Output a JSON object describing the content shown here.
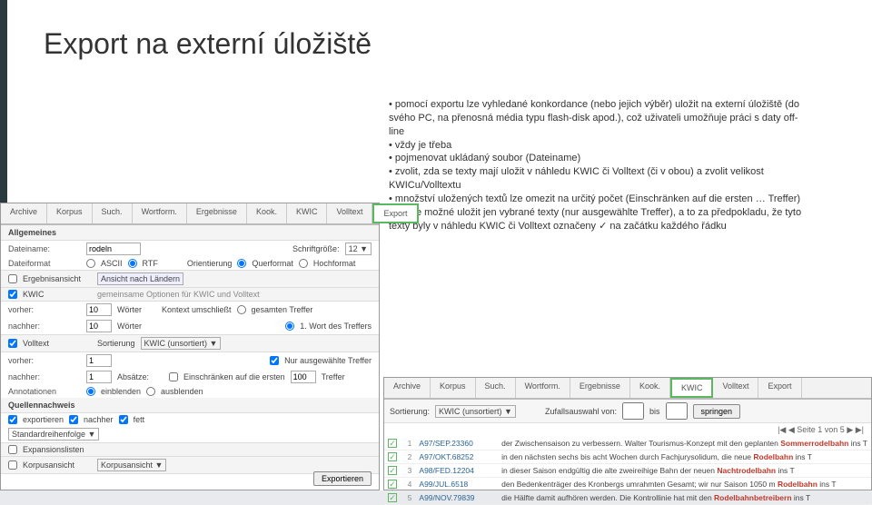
{
  "title": "Export na externí úložiště",
  "explain": [
    "• pomocí exportu lze vyhledané konkordance (nebo jejich výběr) uložit na externí úložiště (do svého PC, na přenosná média typu flash-disk apod.), což uživateli umožňuje práci s daty off-line",
    "• vždy je třeba",
    "• pojmenovat ukládaný soubor (Dateiname)",
    "• zvolit, zda se texty mají uložit v náhledu KWIC či Volltext (či v obou) a zvolit velikost KWICu/Volltextu",
    "• množství uložených textů lze omezit na určitý počet (Einschränken auf die ersten … Treffer) nebo je možné uložit jen vybrané texty (nur ausgewählte Treffer), a to za předpokladu, že tyto texty byly v náhledu KWIC či Volltext označeny ✓ na začátku každého řádku"
  ],
  "menu1": [
    "Archive",
    "Korpus",
    "Such.",
    "Wortform.",
    "Ergebnisse",
    "Kook.",
    "KWIC",
    "Volltext",
    "Export"
  ],
  "menu2": [
    "Archive",
    "Korpus",
    "Such.",
    "Wortform.",
    "Ergebnisse",
    "Kook.",
    "KWIC",
    "Volltext",
    "Export"
  ],
  "shot1": {
    "sect_allg": "Allgemeines",
    "dateiname_lab": "Dateiname:",
    "dateiname_val": "rodeln",
    "schrift_lab": "Schriftgröße:",
    "schrift_val": "12 ▼",
    "format_lab": "Dateiformat",
    "ascii": "ASCII",
    "rtf": "RTF",
    "orient_lab": "Orientierung",
    "quer": "Querformat",
    "hoch": "Hochformat",
    "erg_lab": "Ergebnisansicht",
    "ansicht": "Ansicht nach Ländern",
    "gemein": "gemeinsame Optionen für KWIC und Volltext",
    "kwic_lab": "KWIC",
    "vorher": "vorher:",
    "n10": "10",
    "worter": "Wörter",
    "kontext": "Kontext umschließt",
    "gesamt": "gesamten Treffer",
    "erstes": "1. Wort des Treffers",
    "nachher": "nachher:",
    "voll_lab": "Volltext",
    "sort": "Sortierung",
    "kwicun": "KWIC (unsortiert) ▼",
    "nuraus": "Nur ausgewählte Treffer",
    "absatze": "Absätze:",
    "einschr": "Einschränken auf die ersten",
    "n100": "100",
    "treffer": "Treffer",
    "sect_quell": "Quellennachweis",
    "annot": "Annotationen",
    "einbl": "einblenden",
    "ausbl": "ausblenden",
    "exportieren": "exportieren",
    "nachher2": "nachher",
    "fett": "fett",
    "std": "Standardreihenfolge ▼",
    "sect_exp": "Expansionslisten",
    "sect_korp": "Korpusansicht",
    "korpa": "Korpusansicht ▼",
    "btn": "Exportieren"
  },
  "shot2": {
    "sort_lab": "Sortierung:",
    "sort_val": "KWIC (unsortiert) ▼",
    "zufall": "Zufallsauswahl von:",
    "bis": "bis",
    "spring": "springen",
    "pager": "|◀  ◀   Seite 1 von 5  ▶  ▶|",
    "rows": [
      {
        "n": "1",
        "src": "A97/SEP.23360",
        "txt": "der Zwischensaison zu verbessern. Walter Tourismus-Konzept mit den geplanten",
        "hit": "Sommerrodelbahn"
      },
      {
        "n": "2",
        "src": "A97/OKT.68252",
        "txt": "in den nächsten sechs bis acht Wochen durch Fachjurysolidum, die neue",
        "hit": "Rodelbahn"
      },
      {
        "n": "3",
        "src": "A98/FED.12204",
        "txt": "in dieser Saison endgültig die alte zweireihige Bahn der neuen",
        "hit": "Nachtrodelbahn"
      },
      {
        "n": "4",
        "src": "A99/JUL.6518",
        "txt": "den Bedenkenträger des Kronbergs umrahmten Gesamt; wir nur Saison 1050 m",
        "hit": "Rodelbahn"
      },
      {
        "n": "5",
        "src": "A99/NOV.79839",
        "txt": "die Hälfte damit aufhören werden. Die Kontrollinie hat mit den",
        "hit": "Rodelbahnbetreibern"
      }
    ]
  }
}
